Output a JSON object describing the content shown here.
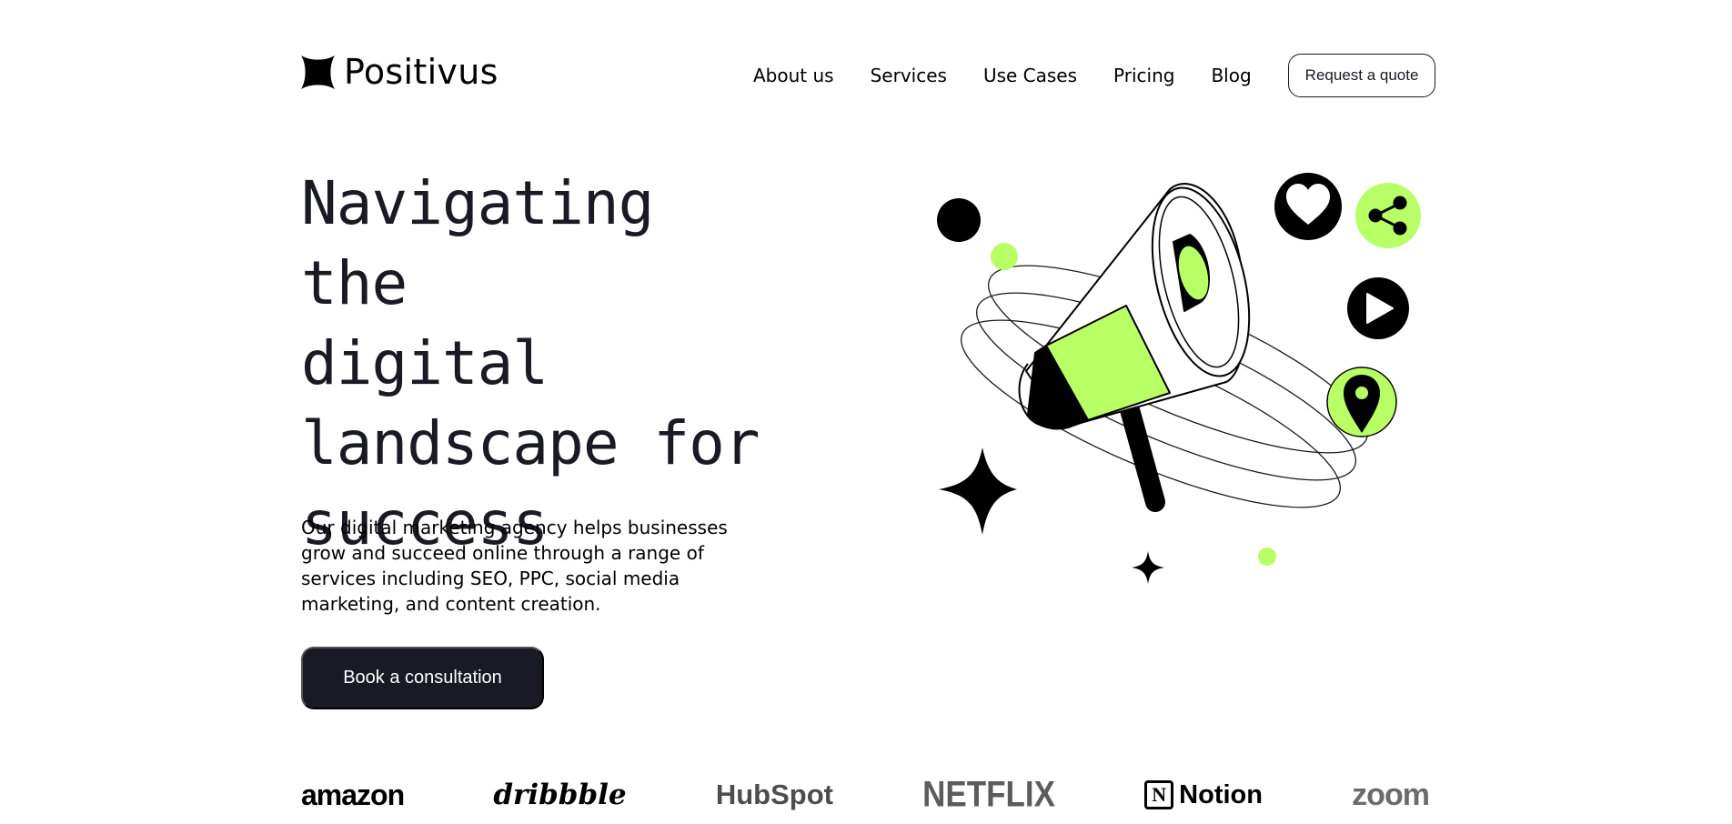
{
  "header": {
    "brand_name": "Positivus",
    "nav_items": [
      "About us",
      "Services",
      "Use Cases",
      "Pricing",
      "Blog"
    ],
    "quote_button": "Request a quote"
  },
  "hero": {
    "title_lines": [
      "Navigating the",
      "digital",
      "landscape for",
      "success"
    ],
    "description": "Our digital marketing agency helps businesses grow and succeed online through a range of services including SEO, PPC, social media marketing, and content creation.",
    "cta_label": "Book a consultation",
    "illustration_icons": [
      "megaphone-icon",
      "heart-icon",
      "share-icon",
      "play-icon",
      "location-pin-icon",
      "sparkle-star-icon"
    ]
  },
  "client_logos": [
    "amazon",
    "dribbble",
    "HubSpot",
    "NETFLIX",
    "Notion",
    "zoom"
  ],
  "colors": {
    "accent": "#B9FF66",
    "dark": "#191A23",
    "background": "#FFFFFF"
  }
}
